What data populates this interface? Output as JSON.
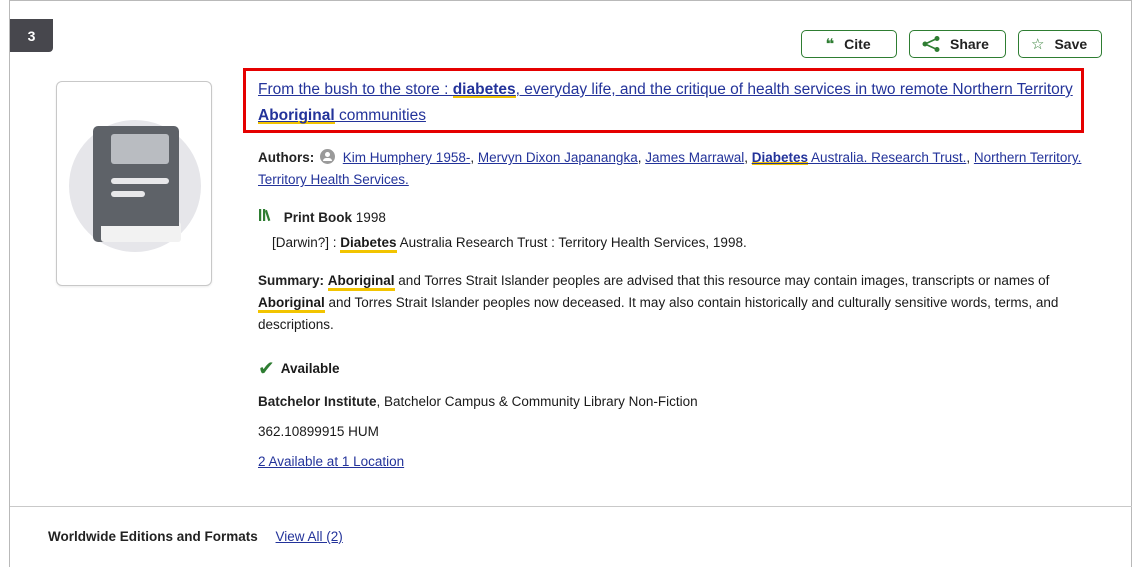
{
  "result": {
    "number": "3"
  },
  "actions": {
    "cite": "Cite",
    "share": "Share",
    "save": "Save"
  },
  "title": {
    "part1": "From the bush to the store : ",
    "hl1": "diabetes",
    "part2": ", everyday life, and the critique of health services in two remote Northern Territory ",
    "hl2": "Aboriginal",
    "part3": " communities"
  },
  "authors": {
    "label": "Authors:",
    "list": [
      {
        "name": "Kim Humphery 1958-",
        "sep": ", "
      },
      {
        "name": "Mervyn Dixon Japanangka",
        "sep": ", "
      },
      {
        "name": "James Marrawal",
        "sep": ", "
      },
      {
        "name_hl": "Diabetes",
        "name": " Australia. Research Trust.",
        "sep": ", "
      },
      {
        "name": "Northern Territory. Territory Health Services.",
        "sep": ""
      }
    ]
  },
  "format": {
    "type": "Print Book",
    "year": "1998"
  },
  "publisher": {
    "pre": "[Darwin?] : ",
    "hl": "Diabetes",
    "post": " Australia Research Trust : Territory Health Services, 1998."
  },
  "summary": {
    "label": "Summary:",
    "hl1": "Aboriginal",
    "t1": " and Torres Strait Islander peoples are advised that this resource may contain images, transcripts or names of ",
    "hl2": "Aboriginal",
    "t2": " and Torres Strait Islander peoples now deceased. It may also contain historically and culturally sensitive words, terms, and descriptions."
  },
  "availability": {
    "status": "Available",
    "institution": "Batchelor Institute",
    "location": ", Batchelor Campus & Community Library Non-Fiction",
    "call_number": "362.10899915 HUM",
    "location_link": "2 Available at 1 Location"
  },
  "editions": {
    "label": "Worldwide Editions and Formats",
    "link": "View All (2)"
  },
  "colors": {
    "accent": "#2e7d32",
    "link": "#23339a",
    "highlight": "#f2c400",
    "focus_box": "#e50000",
    "badge": "#47474d"
  }
}
